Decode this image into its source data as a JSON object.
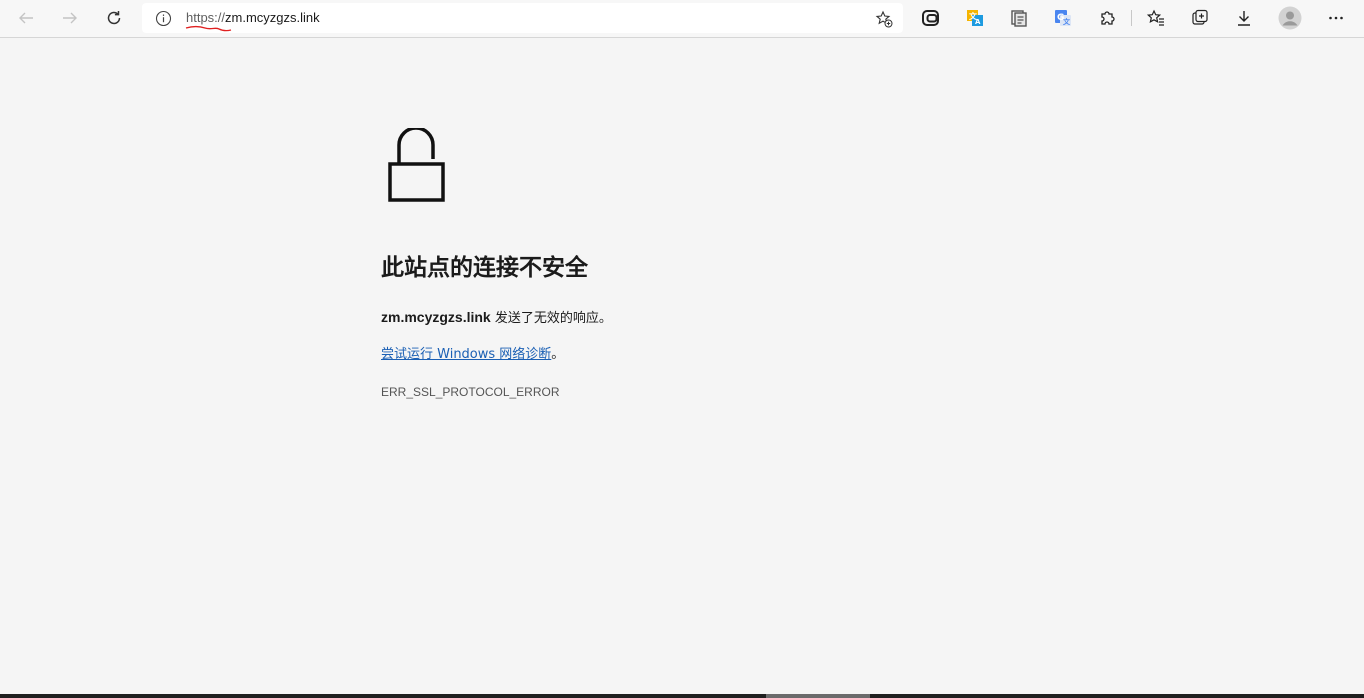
{
  "browser": {
    "url_scheme": "https://",
    "url_host": "zm.mcyzgzs.link",
    "icons": {
      "back": "back-arrow-icon",
      "forward": "forward-arrow-icon",
      "refresh": "refresh-icon",
      "site_info": "info-icon",
      "add_favorite": "star-add-icon",
      "ext1": "extension-link-icon",
      "ext2": "translate-extension-icon",
      "ext3": "clipboard-extension-icon",
      "ext4": "google-translate-icon",
      "extensions": "puzzle-icon",
      "favorites": "favorites-star-icon",
      "collections": "collections-icon",
      "downloads": "download-icon",
      "profile": "profile-avatar-icon",
      "menu": "more-menu-icon"
    }
  },
  "page": {
    "heading": "此站点的连接不安全",
    "host": "zm.mcyzgzs.link",
    "description_suffix": " 发送了无效的响应。",
    "diagnostics_link": "尝试运行 Windows 网络诊断",
    "diagnostics_suffix": "。",
    "error_code": "ERR_SSL_PROTOCOL_ERROR"
  },
  "colors": {
    "page_bg": "#f5f5f5",
    "link": "#1a5fb4",
    "annotation": "#e02020"
  }
}
